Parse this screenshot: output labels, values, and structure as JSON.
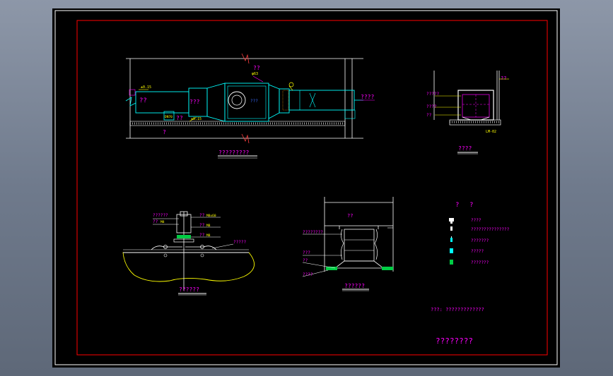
{
  "colors": {
    "frame": "#ffffff",
    "border": "#ff0000",
    "duct": "#00ffff",
    "annotation": "#ff00ff",
    "dimension": "#ffff00",
    "structure": "#ffffff",
    "green": "#00cc44",
    "blue": "#3a6bff"
  },
  "plan": {
    "title": "?????????",
    "labels": {
      "main_left": "??",
      "fan": "???",
      "tag_top": "??",
      "tag_top_sub": "φ63",
      "right_side": "????",
      "bottom_a": "??",
      "bottom_b": "?",
      "small_yellow_a": "±0.15",
      "small_yellow_b": "±0.15",
      "box": "DN70",
      "blue_label": "???"
    }
  },
  "section": {
    "title": "????",
    "labels": {
      "right_tag": "??",
      "a": "?????",
      "b": "????",
      "c": "??",
      "base": "LM-02"
    }
  },
  "mount": {
    "title": "??????",
    "labels": {
      "tl1": "??????",
      "tl2": "??",
      "tl2_sub": "M8",
      "r1": "??",
      "r1_sub": "M8x60",
      "r2": "??",
      "r2_sub": "M8",
      "r3": "??",
      "r3_sub": "M8",
      "r4": "?????"
    }
  },
  "flex": {
    "title": "??????",
    "labels": {
      "top": "??",
      "l1": "????????",
      "l2": "???",
      "l3": "??",
      "l4": "????"
    }
  },
  "legend": {
    "header_a": "?",
    "header_b": "?",
    "items": [
      {
        "icon": "valve-icon",
        "text": "????"
      },
      {
        "icon": "probe-icon",
        "text": "???????????????"
      },
      {
        "icon": "sensor-icon",
        "text": "???????"
      },
      {
        "icon": "cyan-block-icon",
        "text": "?????"
      },
      {
        "icon": "green-block-icon",
        "text": "???????"
      }
    ]
  },
  "notes": {
    "line": "???: ?????????????"
  },
  "sheet_title": "????????"
}
